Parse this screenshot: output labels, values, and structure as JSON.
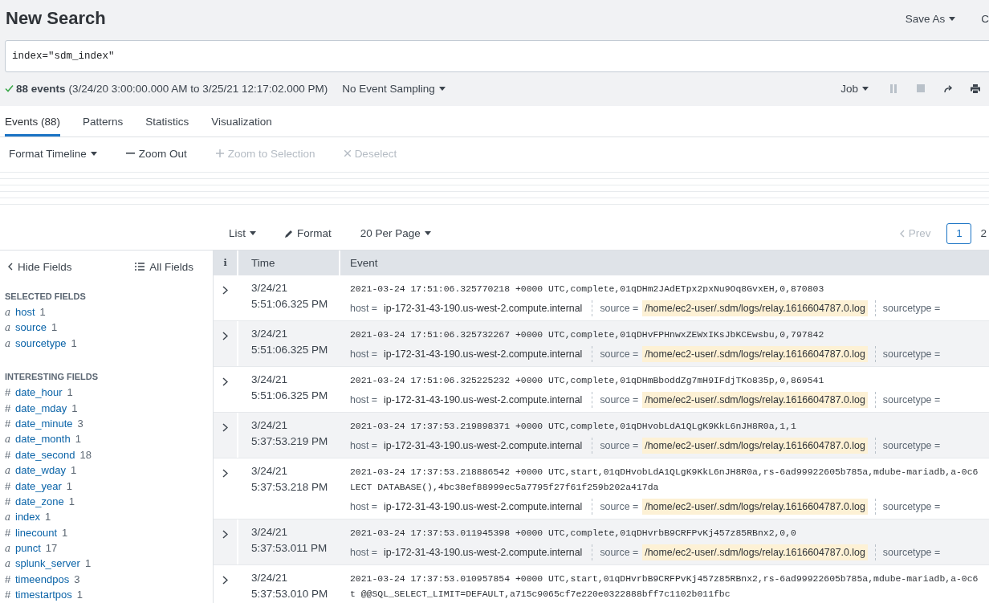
{
  "header": {
    "title": "New Search",
    "actions": [
      {
        "label": "Save As",
        "dropdown": true
      },
      {
        "label": "C",
        "dropdown": false
      }
    ]
  },
  "search": {
    "value": "index=\"sdm_index\""
  },
  "status": {
    "count": "88 events",
    "range": "(3/24/20 3:00:00.000 AM to 3/25/21 12:17:02.000 PM)",
    "sampling": "No Event Sampling",
    "job": "Job",
    "controls": [
      {
        "kind": "pause",
        "disabled": true
      },
      {
        "kind": "stop",
        "disabled": true
      },
      {
        "kind": "share",
        "disabled": false
      },
      {
        "kind": "print",
        "disabled": false
      }
    ]
  },
  "tabs": [
    {
      "label": "Events (88)",
      "selected": true
    },
    {
      "label": "Patterns",
      "selected": false
    },
    {
      "label": "Statistics",
      "selected": false
    },
    {
      "label": "Visualization",
      "selected": false
    }
  ],
  "timeline_toolbar": [
    {
      "kind": "menu",
      "label": "Format Timeline",
      "disabled": false
    },
    {
      "kind": "zoom-out",
      "label": "Zoom Out",
      "disabled": false
    },
    {
      "kind": "zoom-in",
      "label": "Zoom to Selection",
      "disabled": true
    },
    {
      "kind": "deselect",
      "label": "Deselect",
      "disabled": true
    }
  ],
  "results_toolbar": [
    {
      "kind": "menu",
      "label": "List"
    },
    {
      "kind": "format",
      "label": "Format"
    },
    {
      "kind": "menu",
      "label": "20 Per Page"
    }
  ],
  "pager": {
    "prev": {
      "label": "Prev",
      "disabled": true
    },
    "pages": [
      {
        "label": "1",
        "selected": true
      },
      {
        "label": "2",
        "selected": false
      }
    ]
  },
  "sidebar": {
    "hide": "Hide Fields",
    "all": "All Fields",
    "sections": [
      {
        "title": "SELECTED FIELDS",
        "fields": [
          {
            "kind": "string",
            "glyph": "a",
            "name": "host",
            "count": "1"
          },
          {
            "kind": "string",
            "glyph": "a",
            "name": "source",
            "count": "1"
          },
          {
            "kind": "string",
            "glyph": "a",
            "name": "sourcetype",
            "count": "1"
          }
        ]
      },
      {
        "title": "INTERESTING FIELDS",
        "fields": [
          {
            "kind": "number",
            "glyph": "#",
            "name": "date_hour",
            "count": "1"
          },
          {
            "kind": "number",
            "glyph": "#",
            "name": "date_mday",
            "count": "1"
          },
          {
            "kind": "number",
            "glyph": "#",
            "name": "date_minute",
            "count": "3"
          },
          {
            "kind": "string",
            "glyph": "a",
            "name": "date_month",
            "count": "1"
          },
          {
            "kind": "number",
            "glyph": "#",
            "name": "date_second",
            "count": "18"
          },
          {
            "kind": "string",
            "glyph": "a",
            "name": "date_wday",
            "count": "1"
          },
          {
            "kind": "number",
            "glyph": "#",
            "name": "date_year",
            "count": "1"
          },
          {
            "kind": "number",
            "glyph": "#",
            "name": "date_zone",
            "count": "1"
          },
          {
            "kind": "string",
            "glyph": "a",
            "name": "index",
            "count": "1"
          },
          {
            "kind": "number",
            "glyph": "#",
            "name": "linecount",
            "count": "1"
          },
          {
            "kind": "string",
            "glyph": "a",
            "name": "punct",
            "count": "17"
          },
          {
            "kind": "string",
            "glyph": "a",
            "name": "splunk_server",
            "count": "1"
          },
          {
            "kind": "number",
            "glyph": "#",
            "name": "timeendpos",
            "count": "3"
          },
          {
            "kind": "number",
            "glyph": "#",
            "name": "timestartpos",
            "count": "1"
          }
        ]
      }
    ]
  },
  "table": {
    "columns": [
      "i",
      "Time",
      "Event"
    ],
    "rows": [
      {
        "time": [
          "3/24/21",
          "5:51:06.325 PM"
        ],
        "raw": [
          "2021-03-24 17:51:06.325770218 +0000 UTC,complete,01qDHm2JAdETpx2pxNu9Oq8GvxEH,0,870803"
        ],
        "fields": [
          {
            "label": "host =",
            "value": "ip-172-31-43-190.us-west-2.compute.internal",
            "highlighted": false
          },
          {
            "label": "source =",
            "value": "/home/ec2-user/.sdm/logs/relay.1616604787.0.log",
            "highlighted": true
          },
          {
            "label": "sourcetype =",
            "highlighted": false
          }
        ]
      },
      {
        "time": [
          "3/24/21",
          "5:51:06.325 PM"
        ],
        "raw": [
          "2021-03-24 17:51:06.325732267 +0000 UTC,complete,01qDHvFPHnwxZEWxIKsJbKCEwsbu,0,797842"
        ],
        "fields": [
          {
            "label": "host =",
            "value": "ip-172-31-43-190.us-west-2.compute.internal",
            "highlighted": false
          },
          {
            "label": "source =",
            "value": "/home/ec2-user/.sdm/logs/relay.1616604787.0.log",
            "highlighted": true
          },
          {
            "label": "sourcetype =",
            "highlighted": false
          }
        ]
      },
      {
        "time": [
          "3/24/21",
          "5:51:06.325 PM"
        ],
        "raw": [
          "2021-03-24 17:51:06.325225232 +0000 UTC,complete,01qDHmBboddZg7mH9IFdjTKo835p,0,869541"
        ],
        "fields": [
          {
            "label": "host =",
            "value": "ip-172-31-43-190.us-west-2.compute.internal",
            "highlighted": false
          },
          {
            "label": "source =",
            "value": "/home/ec2-user/.sdm/logs/relay.1616604787.0.log",
            "highlighted": true
          },
          {
            "label": "sourcetype =",
            "highlighted": false
          }
        ]
      },
      {
        "time": [
          "3/24/21",
          "5:37:53.219 PM"
        ],
        "raw": [
          "2021-03-24 17:37:53.219898371 +0000 UTC,complete,01qDHvobLdA1QLgK9KkL6nJH8R0a,1,1"
        ],
        "fields": [
          {
            "label": "host =",
            "value": "ip-172-31-43-190.us-west-2.compute.internal",
            "highlighted": false
          },
          {
            "label": "source =",
            "value": "/home/ec2-user/.sdm/logs/relay.1616604787.0.log",
            "highlighted": true
          },
          {
            "label": "sourcetype =",
            "highlighted": false
          }
        ]
      },
      {
        "time": [
          "3/24/21",
          "5:37:53.218 PM"
        ],
        "raw": [
          "2021-03-24 17:37:53.218886542 +0000 UTC,start,01qDHvobLdA1QLgK9KkL6nJH8R0a,rs-6ad99922605b785a,mdube-mariadb,a-0c6",
          "LECT DATABASE(),4bc38ef88999ec5a7795f27f61f259b202a417da"
        ],
        "fields": [
          {
            "label": "host =",
            "value": "ip-172-31-43-190.us-west-2.compute.internal",
            "highlighted": false
          },
          {
            "label": "source =",
            "value": "/home/ec2-user/.sdm/logs/relay.1616604787.0.log",
            "highlighted": true
          },
          {
            "label": "sourcetype =",
            "highlighted": false
          }
        ]
      },
      {
        "time": [
          "3/24/21",
          "5:37:53.011 PM"
        ],
        "raw": [
          "2021-03-24 17:37:53.011945398 +0000 UTC,complete,01qDHvrbB9CRFPvKj457z85RBnx2,0,0"
        ],
        "fields": [
          {
            "label": "host =",
            "value": "ip-172-31-43-190.us-west-2.compute.internal",
            "highlighted": false
          },
          {
            "label": "source =",
            "value": "/home/ec2-user/.sdm/logs/relay.1616604787.0.log",
            "highlighted": true
          },
          {
            "label": "sourcetype =",
            "highlighted": false
          }
        ]
      },
      {
        "time": [
          "3/24/21",
          "5:37:53.010 PM"
        ],
        "raw": [
          "2021-03-24 17:37:53.010957854 +0000 UTC,start,01qDHvrbB9CRFPvKj457z85RBnx2,rs-6ad99922605b785a,mdube-mariadb,a-0c6",
          "t @@SQL_SELECT_LIMIT=DEFAULT,a715c9065cf7e220e0322888bff7c1102b011fbc"
        ],
        "fields": []
      }
    ]
  }
}
